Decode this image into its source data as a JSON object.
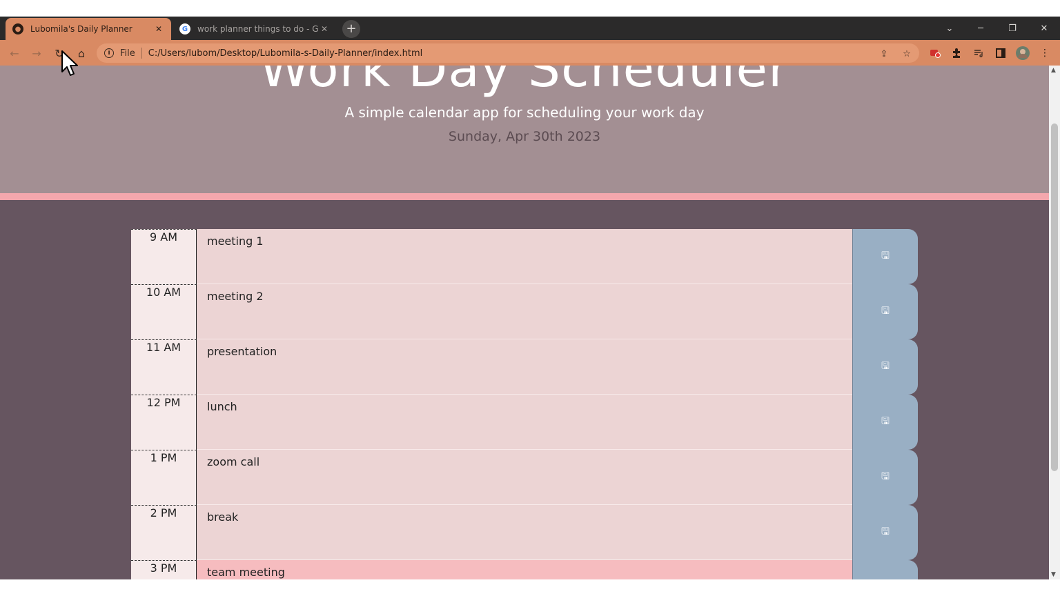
{
  "browser": {
    "tabs": [
      {
        "title": "Lubomila's Daily Planner",
        "close": "✕"
      },
      {
        "title": "work planner things to do - Goo",
        "close": "✕"
      }
    ],
    "new_tab": "+",
    "window_controls": {
      "tab_search": "⌄",
      "minimize": "─",
      "restore": "❐",
      "close": "✕"
    },
    "nav": {
      "back": "←",
      "forward": "→",
      "reload": "↻",
      "home": "⌂"
    },
    "address": {
      "scheme": "File",
      "url": "C:/Users/lubom/Desktop/Lubomila-s-Daily-Planner/index.html"
    },
    "icons": [
      "share-icon",
      "bookmark-star-icon",
      "extension-record-icon",
      "puzzle-extensions-icon",
      "media-queue-icon",
      "side-panel-icon",
      "profile-avatar-icon",
      "kebab-menu-icon"
    ]
  },
  "header": {
    "title": "Work Day Scheduler",
    "lead": "A simple calendar app for scheduling your work day",
    "date": "Sunday, Apr 30th 2023"
  },
  "schedule": [
    {
      "hour": "9 AM",
      "text": "meeting 1",
      "state": "past"
    },
    {
      "hour": "10 AM",
      "text": "meeting 2",
      "state": "past"
    },
    {
      "hour": "11 AM",
      "text": "presentation",
      "state": "past"
    },
    {
      "hour": "12 PM",
      "text": "lunch",
      "state": "past"
    },
    {
      "hour": "1 PM",
      "text": "zoom call",
      "state": "past"
    },
    {
      "hour": "2 PM",
      "text": "break",
      "state": "past"
    },
    {
      "hour": "3 PM",
      "text": "team meeting",
      "state": "present"
    }
  ],
  "colors": {
    "tab_active": "#d98a63",
    "jumbotron": "#a38f93",
    "accent_line": "#f4a7ad",
    "page_bg": "#665560",
    "past": "#ecd4d4",
    "present": "#f6bcbf",
    "save_button": "#99afc4"
  }
}
